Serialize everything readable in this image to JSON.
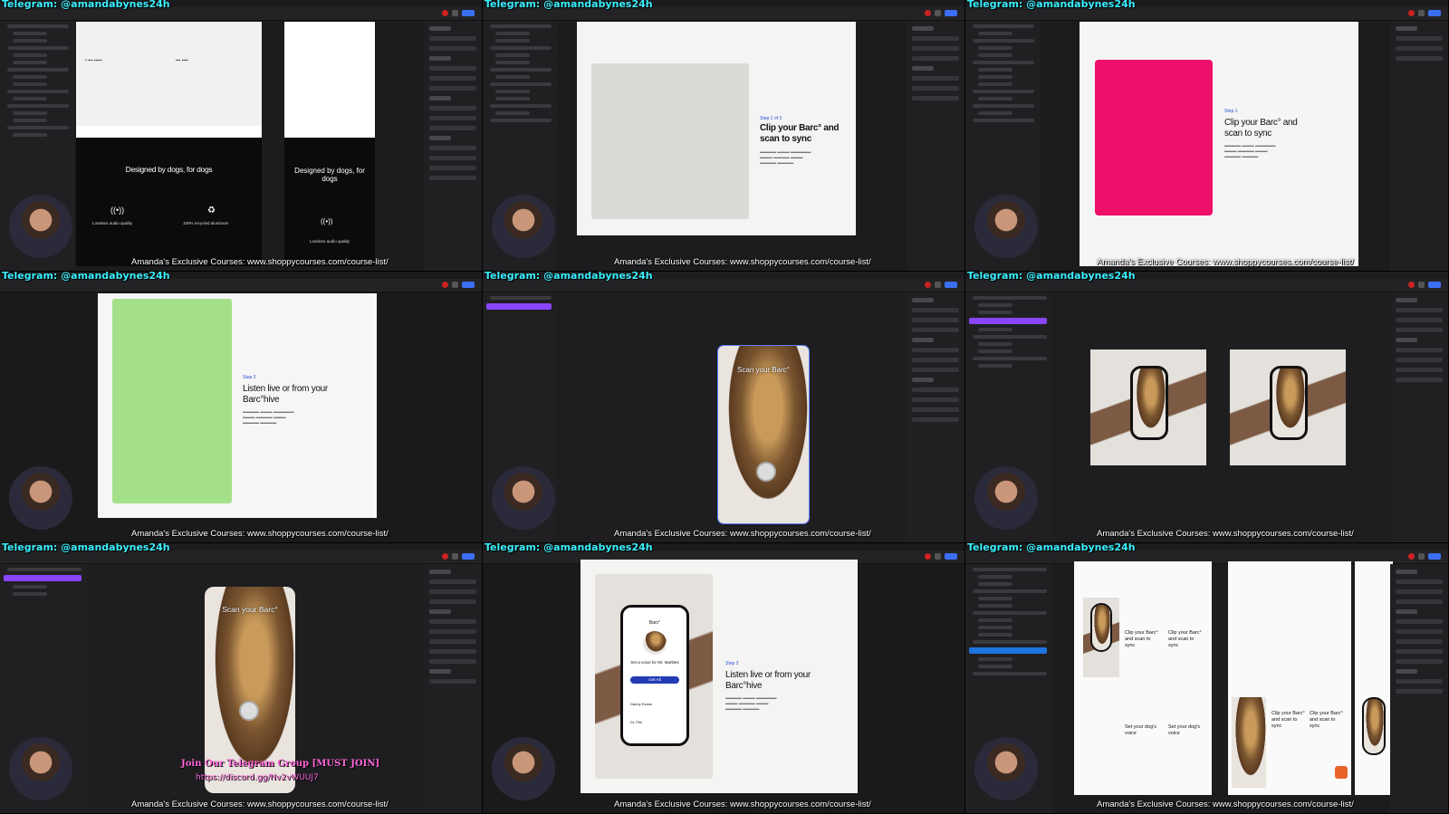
{
  "overlay": {
    "telegram_text": "Telegram: @amandabynes24h",
    "watermark_text": "Amanda's Exclusive Courses: www.shoppycourses.com/course-list/",
    "join_text": "Join Our Telegram Group [MUST JOIN]",
    "join_link": "https://discord.gg/Nv2vWUUJ7"
  },
  "tiles": [
    {
      "id": "t1",
      "features": [
        {
          "title": "Designed by dogs, for dogs"
        },
        {
          "title": "Lossless audio quality"
        },
        {
          "title": "100% recycled aluminum"
        }
      ],
      "side_title": "Designed by dogs, for dogs",
      "side_subtitle": "Lossless audio quality"
    },
    {
      "id": "t2",
      "step_label": "Step 1 of 3",
      "title": "Clip your Barc° and scan to sync"
    },
    {
      "id": "t3",
      "step_label": "Step 1",
      "title": "Clip your Barc° and scan to sync",
      "accent_color": "#ee0f6b"
    },
    {
      "id": "t4",
      "step_label": "Step 2",
      "title": "Listen live or from your Barc°hive",
      "accent_color": "#a4e08a"
    },
    {
      "id": "t5",
      "overlay_title": "Scan your Barc°"
    },
    {
      "id": "t6"
    },
    {
      "id": "t7",
      "overlay_title": "Scan your Barc°"
    },
    {
      "id": "t8",
      "app_brand": "Barc°",
      "app_heading": "Set a voice for Mr. Marbles",
      "app_button": "Get All",
      "list_item_1": "Danny Evans",
      "list_item_2": "Dr. Phil",
      "step_label": "Step 2",
      "title": "Listen live or from your Barc°hive"
    },
    {
      "id": "t9",
      "col_titles": [
        "Clip your Barc° and scan to sync",
        "Clip your Barc° and scan to sync"
      ],
      "bottom_titles": [
        "Set your dog's voice",
        "Set your dog's voice"
      ],
      "stack_titles": [
        "Clip your Barc° and scan to sync",
        "Clip your Barc° and scan to sync"
      ]
    }
  ]
}
